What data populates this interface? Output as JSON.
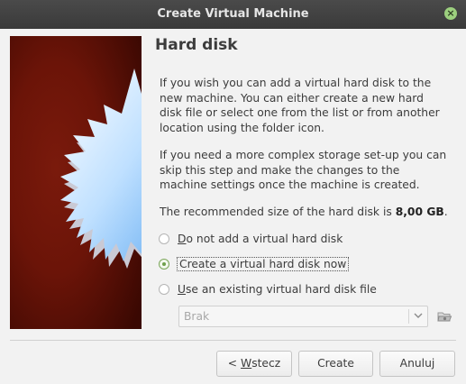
{
  "window": {
    "title": "Create Virtual Machine"
  },
  "heading": "Hard disk",
  "paragraphs": {
    "intro": "If you wish you can add a virtual hard disk to the new machine. You can either create a new hard disk file or select one from the list or from another location using the folder icon.",
    "complex": "If you need a more complex storage set-up you can skip this step and make the changes to the machine settings once the machine is created.",
    "recommended_prefix": "The recommended size of the hard disk is ",
    "recommended_size": "8,00 GB",
    "recommended_suffix": "."
  },
  "options": [
    {
      "mnemonic": "D",
      "rest": "o not add a virtual hard disk",
      "checked": false
    },
    {
      "label": "Create a virtual hard disk now",
      "checked": true
    },
    {
      "mnemonic": "U",
      "rest": "se an existing virtual hard disk file",
      "checked": false
    }
  ],
  "existing_disk_combo": {
    "value": "Brak"
  },
  "buttons": {
    "back_prefix": "< ",
    "back_mnemonic": "W",
    "back_rest": "stecz",
    "create": "Create",
    "cancel": "Anuluj"
  },
  "icons": {
    "close": "close-icon",
    "folder": "folder-open-icon",
    "dropdown": "chevron-down-icon",
    "side_image": "starburst-image"
  }
}
